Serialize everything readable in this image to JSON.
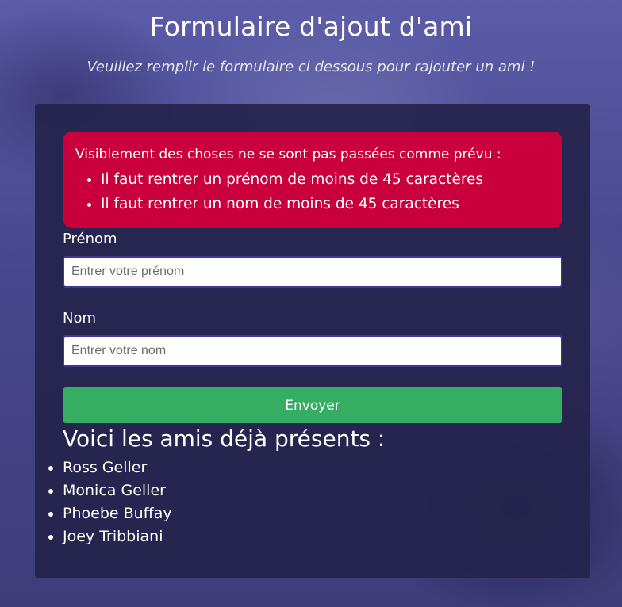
{
  "header": {
    "title": "Formulaire d'ajout d'ami",
    "subtitle": "Veuillez remplir le formulaire ci dessous pour rajouter un ami !"
  },
  "alert": {
    "title": "Visiblement des choses ne se sont pas passées comme prévu :",
    "errors": [
      "Il faut rentrer un prénom de moins de 45 caractères",
      "Il faut rentrer un nom de moins de 45 caractères"
    ],
    "color": "#c9003c"
  },
  "form": {
    "first_name": {
      "label": "Prénom",
      "value": "",
      "placeholder": "Entrer votre prénom"
    },
    "last_name": {
      "label": "Nom",
      "value": "",
      "placeholder": "Entrer votre nom"
    },
    "submit_label": "Envoyer",
    "submit_color": "#35ad62"
  },
  "friends": {
    "heading": "Voici les amis déjà présents :",
    "items": [
      "Ross Geller",
      "Monica Geller",
      "Phoebe Buffay",
      "Joey Tribbiani"
    ]
  }
}
